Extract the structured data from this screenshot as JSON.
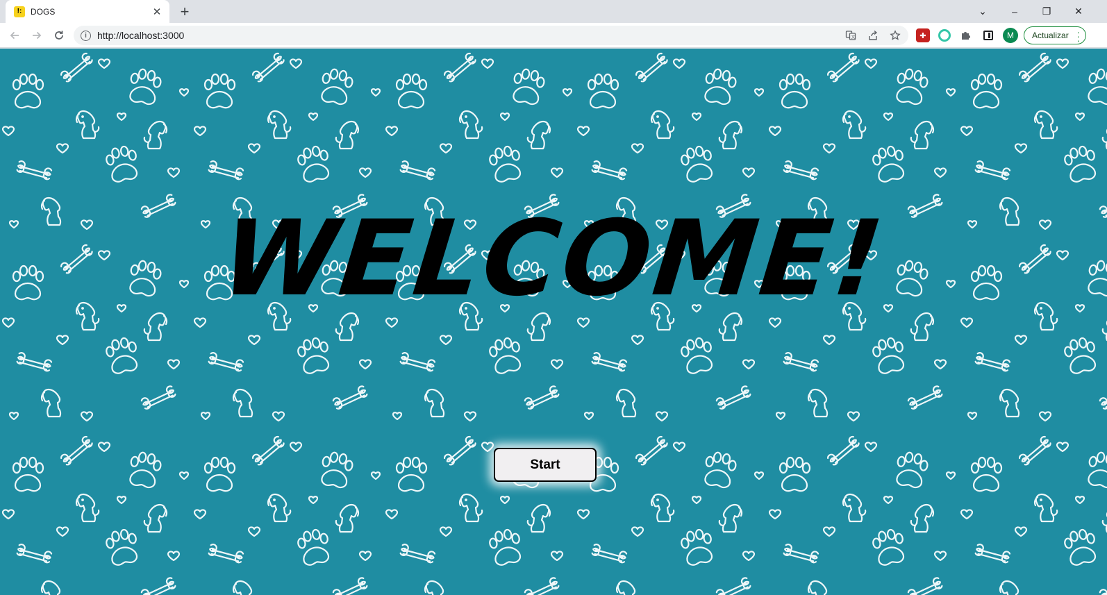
{
  "browser": {
    "tab": {
      "title": "DOGS",
      "favicon_glyph": "!:"
    },
    "new_tab_label": "+",
    "window_controls": {
      "dropdown": "⌄",
      "minimize": "–",
      "restore": "❐",
      "close": "✕"
    },
    "address_bar": {
      "url": "http://localhost:3000"
    },
    "profile_initial": "M",
    "update_button_label": "Actualizar",
    "icons": [
      "back-icon",
      "forward-icon",
      "reload-icon",
      "info-icon",
      "translate-icon",
      "share-icon",
      "bookmark-star-icon",
      "extension-red-icon",
      "extension-ring-icon",
      "extensions-puzzle-icon",
      "side-panel-icon",
      "more-icon"
    ]
  },
  "page": {
    "heading": "WELCOME!",
    "start_button_label": "Start",
    "background_color": "#1f8da2",
    "pattern_motifs": [
      "paw-icon",
      "bone-icon",
      "heart-icon",
      "puppy-icon"
    ]
  }
}
